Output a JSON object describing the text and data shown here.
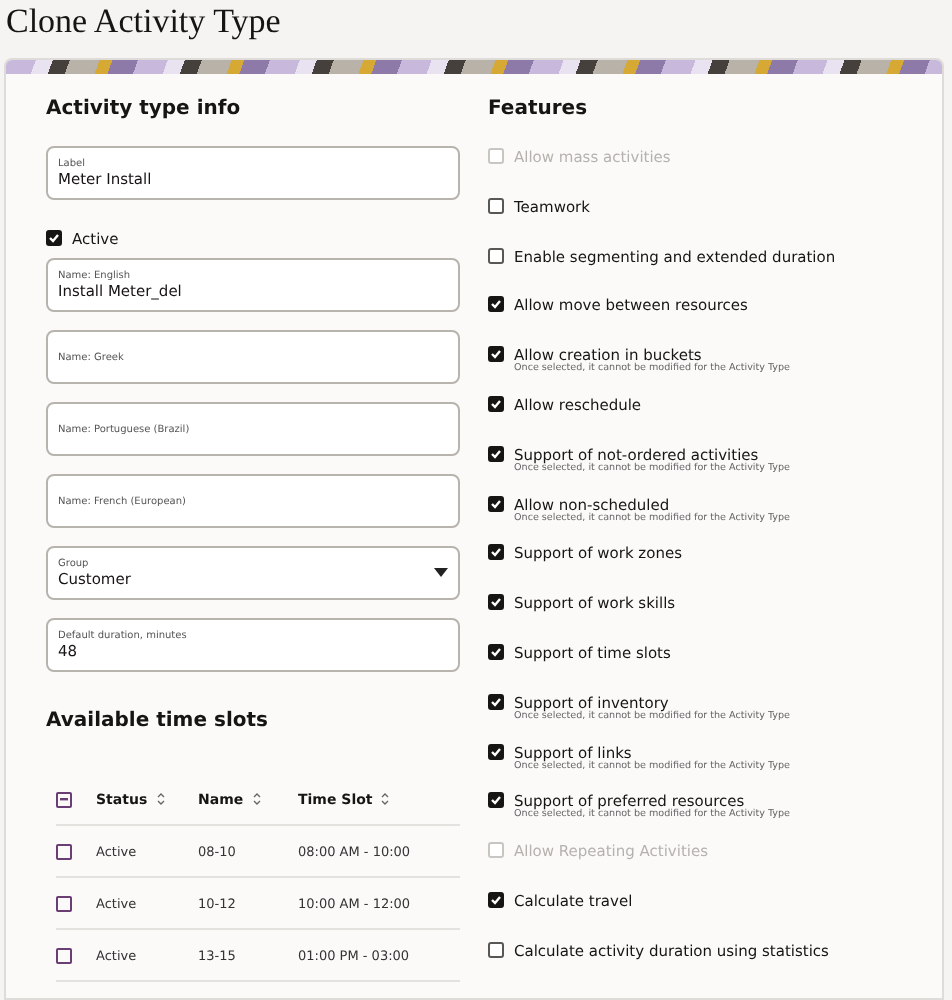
{
  "title": "Clone Activity Type",
  "info": {
    "heading": "Activity type info",
    "fields": [
      {
        "kind": "text",
        "label": "Label",
        "value": "Meter Install"
      },
      {
        "kind": "checkbox",
        "label": "Active",
        "checked": true
      },
      {
        "kind": "text",
        "label": "Name: English",
        "value": "Install Meter_del"
      },
      {
        "kind": "text",
        "placeholder": "Name: Greek"
      },
      {
        "kind": "text",
        "placeholder": "Name: Portuguese (Brazil)"
      },
      {
        "kind": "text",
        "placeholder": "Name: French (European)"
      },
      {
        "kind": "select",
        "label": "Group",
        "value": "Customer"
      },
      {
        "kind": "text",
        "label": "Default duration, minutes",
        "value": "48"
      }
    ]
  },
  "time_slots": {
    "heading": "Available time slots",
    "select_all_indeterminate": true,
    "columns": [
      "Status",
      "Name",
      "Time Slot"
    ],
    "rows": [
      {
        "checked": false,
        "cells": [
          "Active",
          "08-10",
          "08:00 AM - 10:00"
        ]
      },
      {
        "checked": false,
        "cells": [
          "Active",
          "10-12",
          "10:00 AM - 12:00"
        ]
      },
      {
        "checked": false,
        "cells": [
          "Active",
          "13-15",
          "01:00 PM - 03:00"
        ]
      }
    ]
  },
  "features": {
    "heading": "Features",
    "items": [
      {
        "label": "Allow mass activities",
        "checked": false,
        "disabled": true
      },
      {
        "label": "Teamwork",
        "checked": false,
        "disabled": false
      },
      {
        "label": "Enable segmenting and extended duration",
        "checked": false,
        "disabled": false
      },
      {
        "label": "Allow move between resources",
        "checked": true,
        "disabled": false
      },
      {
        "label": "Allow creation in buckets",
        "checked": true,
        "disabled": false,
        "note": "Once selected, it cannot be modified for the Activity Type"
      },
      {
        "label": "Allow reschedule",
        "checked": true,
        "disabled": false
      },
      {
        "label": "Support of not-ordered activities",
        "checked": true,
        "disabled": false,
        "note": "Once selected, it cannot be modified for the Activity Type"
      },
      {
        "label": "Allow non-scheduled",
        "checked": true,
        "disabled": false,
        "note": "Once selected, it cannot be modified for the Activity Type"
      },
      {
        "label": "Support of work zones",
        "checked": true,
        "disabled": false
      },
      {
        "label": "Support of work skills",
        "checked": true,
        "disabled": false
      },
      {
        "label": "Support of time slots",
        "checked": true,
        "disabled": false
      },
      {
        "label": "Support of inventory",
        "checked": true,
        "disabled": false,
        "note": "Once selected, it cannot be modified for the Activity Type"
      },
      {
        "label": "Support of links",
        "checked": true,
        "disabled": false,
        "note": "Once selected, it cannot be modified for the Activity Type"
      },
      {
        "label": "Support of preferred resources",
        "checked": true,
        "disabled": false,
        "note": "Once selected, it cannot be modified for the Activity Type"
      },
      {
        "label": "Allow Repeating Activities",
        "checked": false,
        "disabled": true
      },
      {
        "label": "Calculate travel",
        "checked": true,
        "disabled": false
      },
      {
        "label": "Calculate activity duration using statistics",
        "checked": false,
        "disabled": false
      }
    ]
  }
}
